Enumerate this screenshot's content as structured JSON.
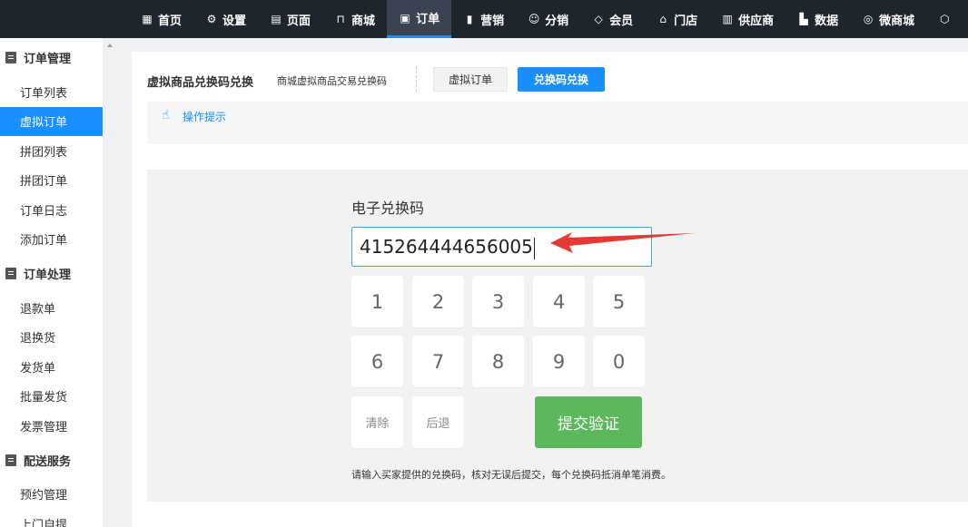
{
  "nav": {
    "items": [
      {
        "label": "首页",
        "icon": "dashboard-icon"
      },
      {
        "label": "设置",
        "icon": "gear-icon"
      },
      {
        "label": "页面",
        "icon": "page-icon"
      },
      {
        "label": "商城",
        "icon": "shop-bag-icon"
      },
      {
        "label": "订单",
        "icon": "order-icon"
      },
      {
        "label": "营销",
        "icon": "chart-bar-icon"
      },
      {
        "label": "分销",
        "icon": "users-icon"
      },
      {
        "label": "会员",
        "icon": "diamond-icon"
      },
      {
        "label": "门店",
        "icon": "store-icon"
      },
      {
        "label": "供应商",
        "icon": "supplier-icon"
      },
      {
        "label": "数据",
        "icon": "data-icon"
      },
      {
        "label": "微商城",
        "icon": "wechat-icon"
      }
    ],
    "active_index": 4
  },
  "sidebar": {
    "groups": [
      {
        "label": "订单管理",
        "icon": "clipboard-icon",
        "items": [
          "订单列表",
          "虚拟订单",
          "拼团列表",
          "拼团订单",
          "订单日志",
          "添加订单"
        ]
      },
      {
        "label": "订单处理",
        "icon": "edit-icon",
        "items": [
          "退款单",
          "退换货",
          "发货单",
          "批量发货",
          "发票管理"
        ]
      },
      {
        "label": "配送服务",
        "icon": "truck-icon",
        "items": [
          "预约管理",
          "上门自提"
        ]
      }
    ],
    "active_item": "虚拟订单"
  },
  "header": {
    "title": "虚拟商品兑换码兑换",
    "subtitle": "商城虚拟商品交易兑换码",
    "tab_virtual": "虚拟订单",
    "tab_redeem": "兑换码兑换"
  },
  "tips": {
    "label": "操作提示"
  },
  "form": {
    "code_label": "电子兑换码",
    "code_value": "415264444656005",
    "keys_row1": [
      "1",
      "2",
      "3",
      "4",
      "5"
    ],
    "keys_row2": [
      "6",
      "7",
      "8",
      "9",
      "0"
    ],
    "clear_label": "清除",
    "back_label": "后退",
    "submit_label": "提交验证",
    "note": "请输入买家提供的兑换码，核对无误后提交，每个兑换码抵消单笔消费。"
  },
  "colors": {
    "primary": "#1890ff",
    "submit": "#5cb85c",
    "topbar": "#1f252c",
    "annotation_arrow": "#e53935"
  }
}
